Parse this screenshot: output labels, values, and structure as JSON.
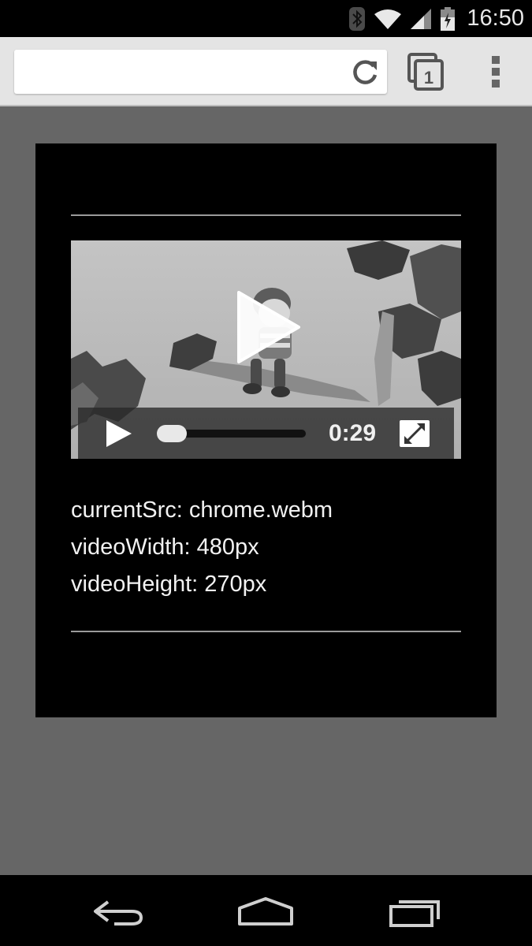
{
  "status_bar": {
    "time": "16:50",
    "icons": [
      "bluetooth-icon",
      "wifi-icon",
      "signal-icon",
      "battery-icon"
    ]
  },
  "browser": {
    "url_value": "",
    "url_placeholder": "",
    "tab_count": "1",
    "icons": [
      "reload-icon",
      "tabs-icon",
      "menu-icon"
    ]
  },
  "video": {
    "current_time": "0:29",
    "progress_fraction": 0.0,
    "icons": [
      "play-icon",
      "fullscreen-icon"
    ]
  },
  "info": {
    "current_src": "currentSrc: chrome.webm",
    "video_width": "videoWidth: 480px",
    "video_height": "videoHeight: 270px"
  },
  "nav_bar": {
    "icons": [
      "back-icon",
      "home-icon",
      "recents-icon"
    ]
  },
  "colors": {
    "page_background": "#666666",
    "content_background": "#000000",
    "toolbar_background": "#e4e4e4"
  }
}
